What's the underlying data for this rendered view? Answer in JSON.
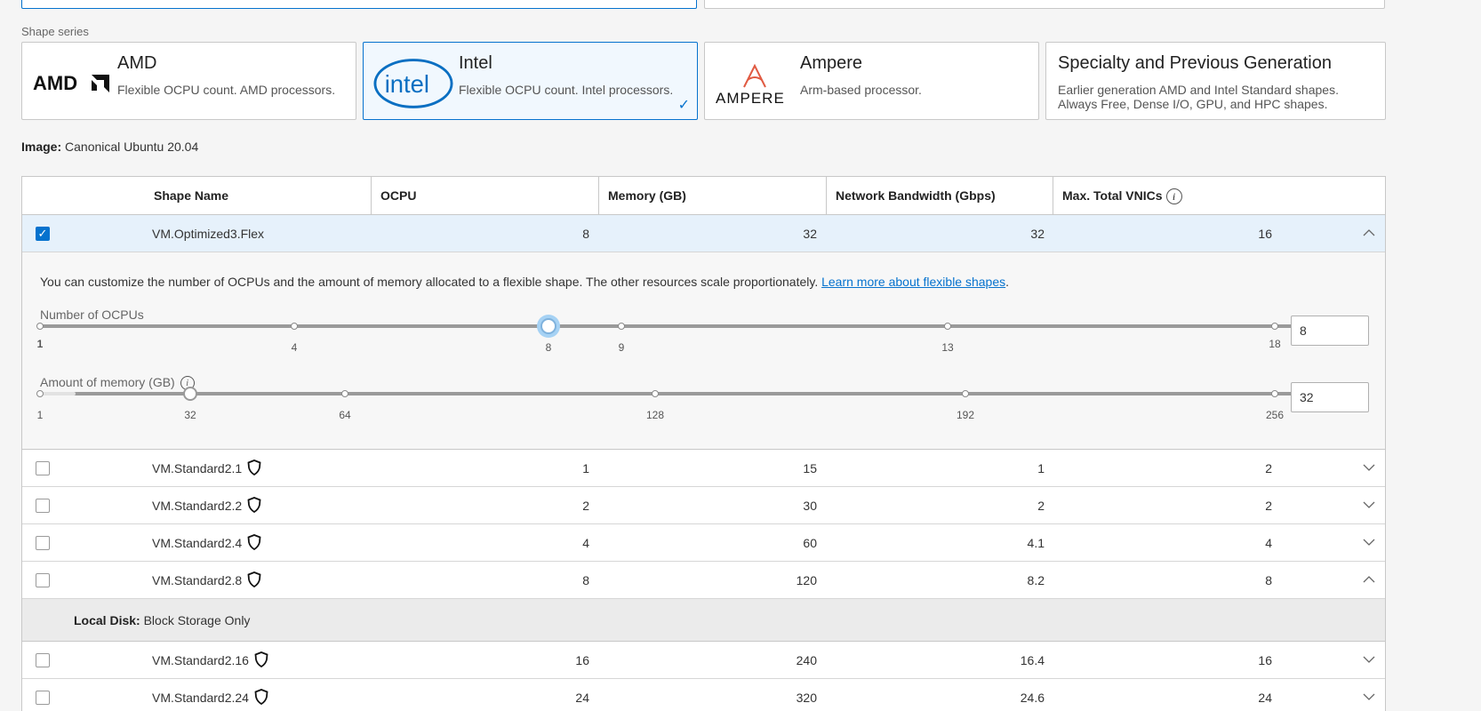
{
  "shape_series": {
    "label": "Shape series",
    "cards": [
      {
        "name": "AMD",
        "description": "Flexible OCPU count. AMD processors.",
        "logo": "AMDA"
      },
      {
        "name": "Intel",
        "description": "Flexible OCPU count. Intel processors.",
        "logo": "intel"
      },
      {
        "name": "Ampere",
        "description": "Arm-based processor.",
        "logo": "AMPERE"
      },
      {
        "name": "Specialty and Previous Generation",
        "description": "Earlier generation AMD and Intel Standard shapes. Always Free, Dense I/O, GPU, and HPC shapes."
      }
    ],
    "selected": "Intel"
  },
  "image": {
    "label": "Image:",
    "value": "Canonical Ubuntu 20.04"
  },
  "table": {
    "headers": [
      "Shape Name",
      "OCPU",
      "Memory (GB)",
      "Network Bandwidth (Gbps)",
      "Max. Total VNICs"
    ],
    "rows": [
      {
        "name": "VM.Optimized3.Flex",
        "ocpu": "8",
        "memory": "32",
        "bandwidth": "32",
        "vnics": "16",
        "checked": true,
        "expanded": true
      },
      {
        "name": "VM.Standard2.1",
        "ocpu": "1",
        "memory": "15",
        "bandwidth": "1",
        "vnics": "2",
        "checked": false,
        "expanded": false
      },
      {
        "name": "VM.Standard2.2",
        "ocpu": "2",
        "memory": "30",
        "bandwidth": "2",
        "vnics": "2",
        "checked": false,
        "expanded": false
      },
      {
        "name": "VM.Standard2.4",
        "ocpu": "4",
        "memory": "60",
        "bandwidth": "4.1",
        "vnics": "4",
        "checked": false,
        "expanded": false
      },
      {
        "name": "VM.Standard2.8",
        "ocpu": "8",
        "memory": "120",
        "bandwidth": "8.2",
        "vnics": "8",
        "checked": false,
        "expanded": true
      },
      {
        "name": "VM.Standard2.16",
        "ocpu": "16",
        "memory": "240",
        "bandwidth": "16.4",
        "vnics": "16",
        "checked": false,
        "expanded": false
      },
      {
        "name": "VM.Standard2.24",
        "ocpu": "24",
        "memory": "320",
        "bandwidth": "24.6",
        "vnics": "24",
        "checked": false,
        "expanded": false
      }
    ]
  },
  "flex_detail": {
    "info_text": "You can customize the number of OCPUs and the amount of memory allocated to a flexible shape. The other resources scale proportionately.",
    "link_text": "Learn more about flexible shapes",
    "ocpu_slider": {
      "label": "Number of OCPUs",
      "min": 1,
      "max": 18,
      "ticks": [
        "1",
        "4",
        "8",
        "9",
        "13",
        "18"
      ],
      "value": 8,
      "input_value": "8"
    },
    "memory_slider": {
      "label": "Amount of memory (GB)",
      "min": 1,
      "max": 256,
      "ticks": [
        "1",
        "32",
        "64",
        "128",
        "192",
        "256"
      ],
      "value": 32,
      "input_value": "32"
    }
  },
  "local_disk": {
    "label": "Local Disk:",
    "value": "Block Storage Only"
  },
  "colors": {
    "accent": "#0572ce",
    "selected_bg": "#f1f8fe",
    "active_row": "#e6f1fb"
  }
}
